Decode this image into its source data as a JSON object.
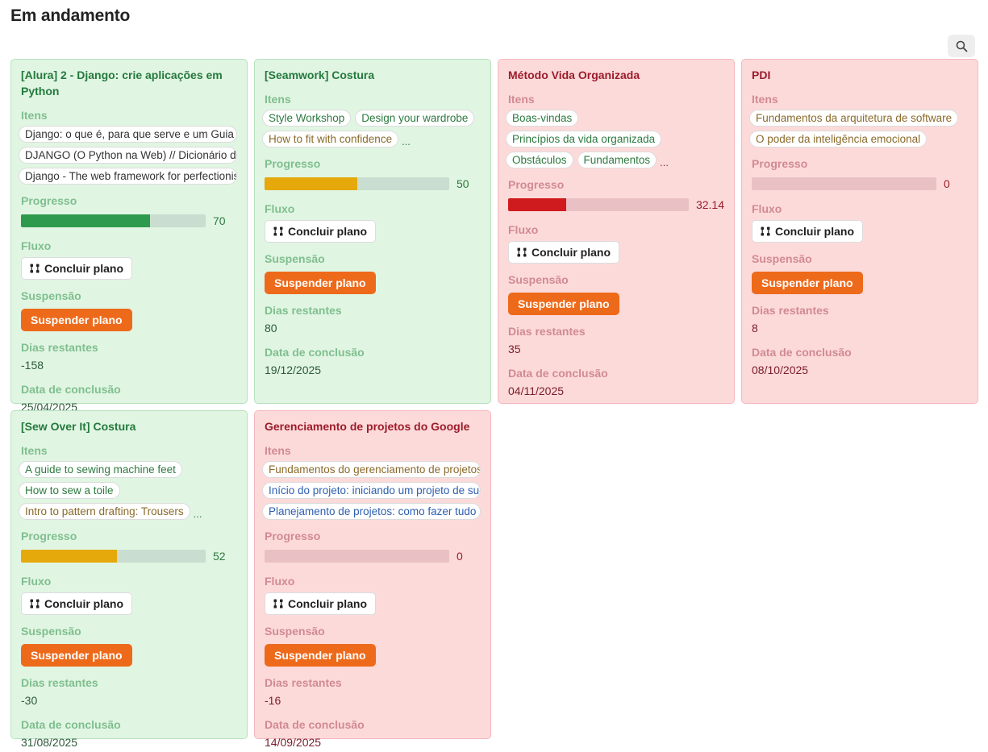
{
  "page": {
    "title": "Em andamento"
  },
  "labels": {
    "items": "Itens",
    "progress": "Progresso",
    "flow": "Fluxo",
    "suspension": "Suspensão",
    "days_remaining": "Dias restantes",
    "completion_date": "Data de conclusão",
    "flow_button": "Concluir plano",
    "suspend_button": "Suspender plano",
    "more": "..."
  },
  "colors": {
    "progress_green": "#2e9a4e",
    "progress_yellow": "#e6a90c",
    "progress_red": "#cf1b1e",
    "suspend_button": "#ee6a1b"
  },
  "cards": [
    {
      "title": "[Alura] 2 - Django: crie aplicações em Python",
      "status": "green",
      "items": [
        {
          "text": "Django: o que é, para que serve e um Guia",
          "color": "dark"
        },
        {
          "text": "DJANGO (O Python na Web) // Dicionário do",
          "color": "dark"
        },
        {
          "text": "Django - The web framework for perfectionists",
          "color": "dark"
        }
      ],
      "has_more": false,
      "progress": 70,
      "progress_color": "progress_green",
      "days_remaining": "-158",
      "completion_date": "25/04/2025"
    },
    {
      "title": "[Seamwork] Costura",
      "status": "green",
      "items": [
        {
          "text": "Style Workshop",
          "color": "green"
        },
        {
          "text": "Design your wardrobe",
          "color": "green"
        },
        {
          "text": "How to fit with confidence",
          "color": "brown"
        }
      ],
      "has_more": true,
      "progress": 50,
      "progress_color": "progress_yellow",
      "days_remaining": "80",
      "completion_date": "19/12/2025"
    },
    {
      "title": "Método Vida Organizada",
      "status": "red",
      "items": [
        {
          "text": "Boas-vindas",
          "color": "green"
        },
        {
          "text": "Princípios da vida organizada",
          "color": "green"
        },
        {
          "text": "Obstáculos",
          "color": "green"
        },
        {
          "text": "Fundamentos",
          "color": "green"
        }
      ],
      "has_more": true,
      "progress": 32.14,
      "progress_color": "progress_red",
      "days_remaining": "35",
      "completion_date": "04/11/2025"
    },
    {
      "title": "PDI",
      "status": "red",
      "items": [
        {
          "text": "Fundamentos da arquitetura de software",
          "color": "brown"
        },
        {
          "text": "O poder da inteligência emocional",
          "color": "brown"
        }
      ],
      "has_more": false,
      "progress": 0,
      "progress_color": "progress_red",
      "days_remaining": "8",
      "completion_date": "08/10/2025"
    },
    {
      "title": "[Sew Over It] Costura",
      "status": "green",
      "items": [
        {
          "text": "A guide to sewing machine feet",
          "color": "green"
        },
        {
          "text": "How to sew a toile",
          "color": "green"
        },
        {
          "text": "Intro to pattern drafting: Trousers",
          "color": "brown"
        }
      ],
      "has_more": true,
      "progress": 52,
      "progress_color": "progress_yellow",
      "days_remaining": "-30",
      "completion_date": "31/08/2025"
    },
    {
      "title": "Gerenciamento de projetos do Google",
      "status": "red",
      "items": [
        {
          "text": "Fundamentos do gerenciamento de projetos",
          "color": "brown"
        },
        {
          "text": "Início do projeto: iniciando um projeto de sucesso",
          "color": "blue"
        },
        {
          "text": "Planejamento de projetos: como fazer tudo",
          "color": "blue"
        }
      ],
      "has_more": false,
      "progress": 0,
      "progress_color": "progress_red",
      "days_remaining": "-16",
      "completion_date": "14/09/2025"
    }
  ]
}
